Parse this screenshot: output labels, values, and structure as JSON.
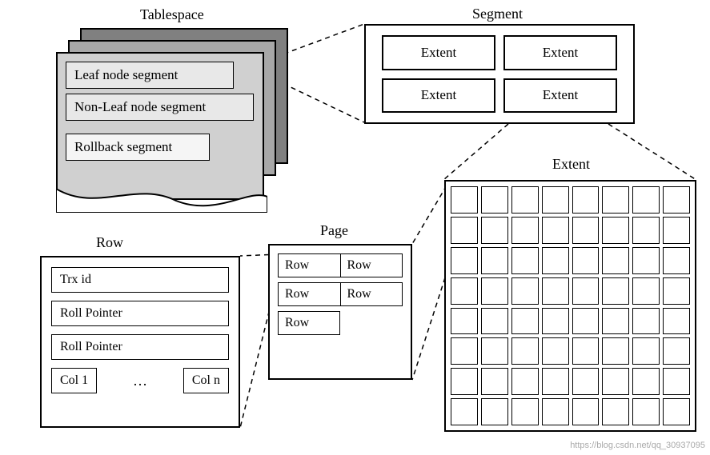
{
  "labels": {
    "tablespace": "Tablespace",
    "segment": "Segment",
    "extent": "Extent",
    "page": "Page",
    "row": "Row"
  },
  "tablespace": {
    "segments": [
      "Leaf node segment",
      "Non-Leaf node segment",
      "Rollback segment"
    ]
  },
  "segment": {
    "cells": [
      "Extent",
      "Extent",
      "Extent",
      "Extent"
    ]
  },
  "extent": {
    "grid_rows": 8,
    "grid_cols": 8
  },
  "page": {
    "rows": [
      "Row",
      "Row",
      "Row",
      "Row",
      "Row"
    ]
  },
  "row": {
    "fields": [
      "Trx id",
      "Roll Pointer",
      "Roll Pointer"
    ],
    "col_first": "Col 1",
    "col_dots": "…",
    "col_last": "Col n"
  },
  "watermark": "https://blog.csdn.net/qq_30937095"
}
